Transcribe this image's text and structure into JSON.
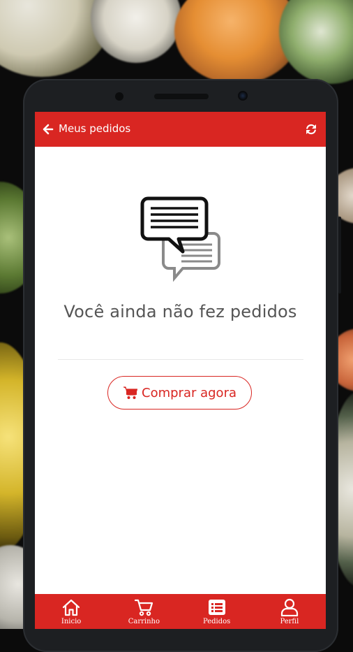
{
  "header": {
    "title": "Meus pedidos",
    "back_icon": "arrow-left-icon",
    "refresh_icon": "refresh-icon"
  },
  "empty_state": {
    "icon": "chat-bubbles-icon",
    "message": "Você ainda não fez pedidos"
  },
  "buy_button": {
    "icon": "shopping-cart-icon",
    "label": "Comprar agora"
  },
  "bottom_nav": {
    "items": [
      {
        "label": "Inicio",
        "icon": "home-icon"
      },
      {
        "label": "Carrinho",
        "icon": "cart-icon"
      },
      {
        "label": "Pedidos",
        "icon": "list-icon"
      },
      {
        "label": "Perfil",
        "icon": "user-icon"
      }
    ]
  },
  "colors": {
    "accent": "#d92622",
    "background": "#ffffff",
    "text_muted": "#555555"
  }
}
